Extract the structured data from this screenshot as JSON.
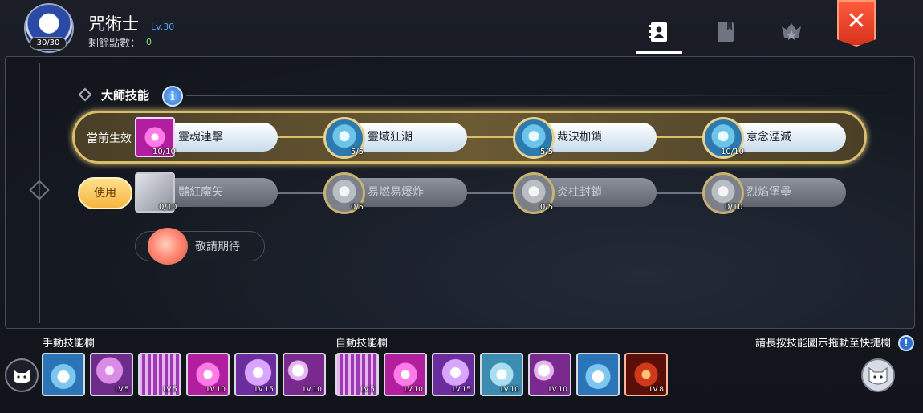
{
  "header": {
    "job_title": "咒術士",
    "job_level": "Lv.30",
    "avatar_badge": "30/30",
    "points_label": "剩餘點數：",
    "points_value": "0",
    "tabs": [
      {
        "name": "skills",
        "icon": "skill-book-icon",
        "active": true
      },
      {
        "name": "codex",
        "icon": "bookmark-book-icon",
        "active": false
      },
      {
        "name": "rank",
        "icon": "star-crest-icon",
        "active": false
      }
    ],
    "close_icon": "close-icon"
  },
  "section": {
    "title": "大師技能",
    "info_icon": "i"
  },
  "active_row": {
    "label": "當前生效",
    "skills": [
      {
        "name": "靈魂連擊",
        "level": "10/10",
        "icon": "pink-burst-icon"
      },
      {
        "name": "靈域狂潮",
        "level": "5/5",
        "icon": "ice-crystal-icon"
      },
      {
        "name": "裁決枷鎖",
        "level": "5/5",
        "icon": "ice-crystal-icon"
      },
      {
        "name": "意念湮滅",
        "level": "10/10",
        "icon": "ice-crystal-icon"
      }
    ]
  },
  "alt_row": {
    "use_button": "使用",
    "skills": [
      {
        "name": "豔紅魔矢",
        "level": "0/10",
        "icon": "grey-arrow-icon"
      },
      {
        "name": "易燃易爆炸",
        "level": "0/5",
        "icon": "grey-crystal-icon"
      },
      {
        "name": "炎柱封鎖",
        "level": "0/5",
        "icon": "grey-crystal-icon"
      },
      {
        "name": "烈焰堡壘",
        "level": "0/10",
        "icon": "grey-crystal-icon"
      }
    ]
  },
  "coming_soon": {
    "label": "敬請期待",
    "icon": "poring-pet-icon"
  },
  "bottom_bar": {
    "manual_label": "手動技能欄",
    "auto_label": "自動技能欄",
    "hint": "請長按技能圖示拖動至快捷欄",
    "hint_icon": "!",
    "manual_slots": [
      {
        "level": "",
        "icon": "cross-spirit-icon"
      },
      {
        "level": "LV.5",
        "icon": "purple-orb-icon"
      },
      {
        "level": "LV.5",
        "icon": "purple-cage-icon"
      },
      {
        "level": "LV.10",
        "icon": "pink-burst-icon"
      },
      {
        "level": "LV.15",
        "icon": "violet-blob-icon"
      },
      {
        "level": "LV.10",
        "icon": "sun-burst-icon"
      }
    ],
    "auto_slots": [
      {
        "level": "LV.5",
        "icon": "purple-cage-icon"
      },
      {
        "level": "LV.10",
        "icon": "pink-burst-icon"
      },
      {
        "level": "LV.15",
        "icon": "violet-blob-icon"
      },
      {
        "level": "LV.10",
        "icon": "ice-arch-icon"
      },
      {
        "level": "LV.10",
        "icon": "sun-burst-icon"
      },
      {
        "level": "",
        "icon": "cross-spirit-icon"
      },
      {
        "level": "LV.8",
        "icon": "fire-hands-icon"
      }
    ]
  },
  "colors": {
    "gold_border": "#d9bd6a",
    "use_button": "#f5b642",
    "close_button": "#d6321e",
    "level_text": "#4fa2ff",
    "points_value": "#7ee36b"
  }
}
